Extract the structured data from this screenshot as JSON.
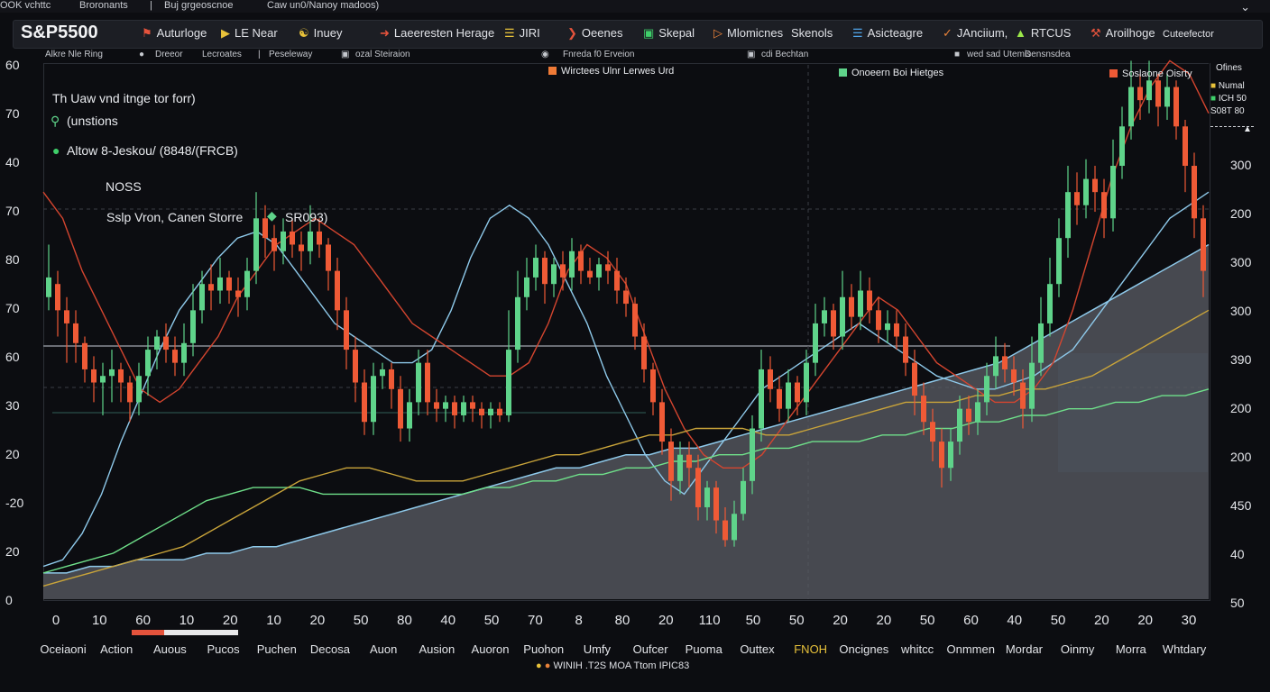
{
  "window": {
    "top_items": [
      "OOK vchttc",
      "Broronants",
      "Buj grgeoscnoe",
      "Caw un0/Nanoy madoos)"
    ]
  },
  "toolbar": {
    "title": "S&P5500",
    "items": [
      {
        "label": "Auturloge",
        "icon": "flag-icon",
        "color": "#e5533c"
      },
      {
        "label": "LE Near",
        "icon": "play-icon",
        "color": "#e8c23a"
      },
      {
        "label": "Inuey",
        "icon": "person-icon",
        "color": "#e8c23a"
      },
      {
        "label": "Laeeresten Herage",
        "icon": "arrow-right-icon",
        "color": "#e5533c"
      },
      {
        "label": "JIRI",
        "icon": "bars-icon",
        "color": "#e8c23a"
      },
      {
        "label": "Oeenes",
        "icon": "chevron-icon",
        "color": "#e5533c"
      },
      {
        "label": "Skepal",
        "icon": "square-icon",
        "color": "#3fcf6a"
      },
      {
        "label": "Mlomicnes",
        "icon": "play-outline-icon",
        "color": "#e8823a"
      },
      {
        "label": "Skenols",
        "icon": "",
        "color": ""
      },
      {
        "label": "Asicteagre",
        "icon": "sliders-icon",
        "color": "#4fa3e8"
      },
      {
        "label": "JAnciium,",
        "icon": "check-icon",
        "color": "#e8823a"
      },
      {
        "label": "RTCUS",
        "icon": "triangle-icon",
        "color": "#9be84a"
      },
      {
        "label": "Aroilhoge",
        "icon": "wrench-icon",
        "color": "#e5533c"
      },
      {
        "label": "Cuteefector",
        "icon": "",
        "color": ""
      }
    ]
  },
  "subbar": {
    "items": [
      "Alkre Nle Ring",
      "Dreeor",
      "Lecroates",
      "Peseleway",
      "ozal Steiraion",
      "Fnreda f0 Erveion",
      "cdi Bechtan",
      "wed sad Utemis",
      "Densnsdea"
    ]
  },
  "annotations": {
    "line1": "Th Uaw vnd itnge tor forr)",
    "line2": "(unstions",
    "line3": "Altow 8-Jeskou/ (8848/(FRCB)",
    "line4": "NOSS",
    "line5": "Sslp Vron, Canen Storre",
    "line5_badge": "SR093)",
    "mid_legend1": "Wirctees Ulnr Lerwes Urd",
    "mid_legend2": "Onoeern Boi Hietges",
    "right_legend": "Soslaone Oisrty"
  },
  "right_legend": {
    "header": "Ofines",
    "items": [
      {
        "label": "Numal",
        "color": "#e8c23a"
      },
      {
        "label": "ICH 50",
        "color": "#3fcf6a"
      },
      {
        "label": "S08T 80",
        "color": "#e8c23a"
      }
    ]
  },
  "footer": {
    "text": "WINIH .T2S MOA Ttom IPIC83"
  },
  "colors": {
    "up": "#5fd38a",
    "down": "#ef5a36",
    "line_blue": "#8ec9ea",
    "line_yellow": "#c9a43a",
    "line_green": "#6fe08a",
    "line_red": "#d4452f",
    "area": "#5b5e66"
  },
  "chart_data": {
    "type": "candlestick",
    "title": "S&P5500",
    "y_left_ticks": [
      "60",
      "70",
      "40",
      "70",
      "80",
      "70",
      "60",
      "30",
      "20",
      "-20",
      "20",
      "0"
    ],
    "y_right_ticks": [
      "300",
      "200",
      "300",
      "300",
      "390",
      "200",
      "200",
      "450",
      "40",
      "50"
    ],
    "x_ticks": [
      "0",
      "10",
      "60",
      "10",
      "20",
      "10",
      "20",
      "50",
      "80",
      "40",
      "50",
      "70",
      "8",
      "80",
      "20",
      "110",
      "50",
      "50",
      "20",
      "20",
      "50",
      "60",
      "40",
      "50",
      "20",
      "20",
      "30"
    ],
    "x_categories": [
      "Oceiaoni",
      "Action",
      "Auous",
      "Pucos",
      "Puchen",
      "Decosa",
      "Auon",
      "Ausion",
      "Auoron",
      "Puohon",
      "Umfy",
      "Oufcer",
      "Puoma",
      "Outtex",
      "FNOH",
      "Oncignes",
      "whitcc",
      "Onmmen",
      "Mordar",
      "Oinmy",
      "Morra",
      "Whtdary"
    ],
    "ylim": [
      0,
      80
    ],
    "candles": [
      [
        0,
        46,
        49,
        54,
        44
      ],
      [
        1,
        48,
        44,
        50,
        40
      ],
      [
        2,
        44,
        42,
        46,
        36
      ],
      [
        3,
        42,
        39,
        44,
        36
      ],
      [
        4,
        39,
        35,
        40,
        33
      ],
      [
        5,
        35,
        33,
        37,
        30
      ],
      [
        6,
        33,
        34,
        36,
        28
      ],
      [
        7,
        34,
        35,
        38,
        30
      ],
      [
        8,
        35,
        33,
        36,
        30
      ],
      [
        9,
        33,
        30,
        34,
        27
      ],
      [
        10,
        30,
        34,
        36,
        28
      ],
      [
        11,
        34,
        38,
        40,
        31
      ],
      [
        12,
        38,
        40,
        41,
        35
      ],
      [
        13,
        40,
        38,
        42,
        36
      ],
      [
        14,
        38,
        36,
        40,
        34
      ],
      [
        15,
        36,
        39,
        42,
        34
      ],
      [
        16,
        39,
        44,
        48,
        37
      ],
      [
        17,
        44,
        48,
        50,
        42
      ],
      [
        18,
        48,
        47,
        51,
        44
      ],
      [
        19,
        47,
        49,
        52,
        45
      ],
      [
        20,
        49,
        47,
        50,
        45
      ],
      [
        21,
        47,
        46,
        49,
        43
      ],
      [
        22,
        46,
        50,
        52,
        44
      ],
      [
        23,
        50,
        58,
        62,
        48
      ],
      [
        24,
        58,
        55,
        60,
        52
      ],
      [
        25,
        55,
        53,
        57,
        50
      ],
      [
        26,
        53,
        56,
        58,
        51
      ],
      [
        27,
        56,
        54,
        58,
        52
      ],
      [
        28,
        54,
        53,
        56,
        50
      ],
      [
        29,
        53,
        56,
        60,
        51
      ],
      [
        30,
        56,
        54,
        58,
        52
      ],
      [
        31,
        54,
        50,
        55,
        47
      ],
      [
        32,
        50,
        44,
        52,
        41
      ],
      [
        33,
        44,
        38,
        46,
        35
      ],
      [
        34,
        38,
        33,
        40,
        30
      ],
      [
        35,
        33,
        27,
        35,
        25
      ],
      [
        36,
        27,
        34,
        36,
        25
      ],
      [
        37,
        34,
        35,
        36,
        32
      ],
      [
        38,
        35,
        32,
        36,
        29
      ],
      [
        39,
        32,
        26,
        34,
        24
      ],
      [
        40,
        26,
        30,
        32,
        24
      ],
      [
        41,
        30,
        36,
        38,
        28
      ],
      [
        42,
        36,
        30,
        38,
        28
      ],
      [
        43,
        30,
        29,
        32,
        27
      ],
      [
        44,
        29,
        30,
        31,
        27
      ],
      [
        45,
        30,
        28,
        31,
        26
      ],
      [
        46,
        28,
        30,
        31,
        27
      ],
      [
        47,
        30,
        29,
        31,
        27
      ],
      [
        48,
        29,
        28,
        30,
        26
      ],
      [
        49,
        28,
        29,
        30,
        26
      ],
      [
        50,
        29,
        28,
        30,
        27
      ],
      [
        51,
        28,
        38,
        44,
        27
      ],
      [
        52,
        38,
        46,
        50,
        36
      ],
      [
        53,
        46,
        49,
        52,
        44
      ],
      [
        54,
        49,
        52,
        54,
        47
      ],
      [
        55,
        52,
        48,
        53,
        45
      ],
      [
        56,
        48,
        51,
        52,
        46
      ],
      [
        57,
        51,
        49,
        53,
        47
      ],
      [
        58,
        49,
        53,
        55,
        47
      ],
      [
        59,
        53,
        50,
        54,
        48
      ],
      [
        60,
        50,
        49,
        52,
        48
      ],
      [
        61,
        49,
        51,
        52,
        47
      ],
      [
        62,
        51,
        50,
        53,
        48
      ],
      [
        63,
        50,
        47,
        52,
        45
      ],
      [
        64,
        47,
        45,
        49,
        43
      ],
      [
        65,
        45,
        40,
        46,
        38
      ],
      [
        66,
        40,
        35,
        42,
        33
      ],
      [
        67,
        35,
        30,
        36,
        28
      ],
      [
        68,
        30,
        24,
        32,
        22
      ],
      [
        69,
        24,
        18,
        26,
        15
      ],
      [
        70,
        18,
        22,
        24,
        16
      ],
      [
        71,
        22,
        20,
        24,
        17
      ],
      [
        72,
        20,
        14,
        22,
        12
      ],
      [
        73,
        14,
        17,
        18,
        12
      ],
      [
        74,
        17,
        12,
        18,
        10
      ],
      [
        75,
        12,
        9,
        14,
        8
      ],
      [
        76,
        9,
        13,
        15,
        8
      ],
      [
        77,
        13,
        18,
        20,
        12
      ],
      [
        78,
        18,
        26,
        28,
        16
      ],
      [
        79,
        26,
        35,
        38,
        24
      ],
      [
        80,
        35,
        32,
        37,
        30
      ],
      [
        81,
        32,
        29,
        34,
        27
      ],
      [
        82,
        29,
        33,
        35,
        27
      ],
      [
        83,
        33,
        30,
        34,
        28
      ],
      [
        84,
        30,
        36,
        38,
        28
      ],
      [
        85,
        36,
        42,
        45,
        34
      ],
      [
        86,
        42,
        44,
        46,
        40
      ],
      [
        87,
        44,
        40,
        45,
        38
      ],
      [
        88,
        40,
        46,
        50,
        38
      ],
      [
        89,
        46,
        43,
        48,
        41
      ],
      [
        90,
        43,
        47,
        50,
        41
      ],
      [
        91,
        47,
        44,
        49,
        42
      ],
      [
        92,
        44,
        41,
        46,
        39
      ],
      [
        93,
        41,
        42,
        44,
        39
      ],
      [
        94,
        42,
        40,
        44,
        38
      ],
      [
        95,
        40,
        36,
        42,
        34
      ],
      [
        96,
        36,
        31,
        38,
        28
      ],
      [
        97,
        31,
        27,
        33,
        25
      ],
      [
        98,
        27,
        24,
        29,
        21
      ],
      [
        99,
        24,
        20,
        26,
        17
      ],
      [
        100,
        20,
        24,
        26,
        18
      ],
      [
        101,
        24,
        29,
        31,
        22
      ],
      [
        102,
        29,
        27,
        31,
        25
      ],
      [
        103,
        27,
        30,
        32,
        25
      ],
      [
        104,
        30,
        34,
        36,
        28
      ],
      [
        105,
        34,
        37,
        40,
        32
      ],
      [
        106,
        37,
        35,
        39,
        33
      ],
      [
        107,
        35,
        33,
        37,
        31
      ],
      [
        108,
        33,
        29,
        35,
        26
      ],
      [
        109,
        29,
        36,
        40,
        27
      ],
      [
        110,
        36,
        42,
        46,
        34
      ],
      [
        111,
        42,
        48,
        52,
        40
      ],
      [
        112,
        48,
        55,
        58,
        46
      ],
      [
        113,
        55,
        62,
        66,
        52
      ],
      [
        114,
        62,
        60,
        65,
        57
      ],
      [
        115,
        60,
        64,
        67,
        58
      ],
      [
        116,
        64,
        62,
        66,
        59
      ],
      [
        117,
        62,
        58,
        64,
        55
      ],
      [
        118,
        58,
        66,
        70,
        56
      ],
      [
        119,
        66,
        72,
        75,
        64
      ],
      [
        120,
        72,
        78,
        82,
        70
      ],
      [
        121,
        78,
        76,
        80,
        73
      ],
      [
        122,
        76,
        79,
        82,
        74
      ],
      [
        123,
        79,
        75,
        80,
        72
      ],
      [
        124,
        75,
        78,
        80,
        73
      ],
      [
        125,
        78,
        72,
        79,
        70
      ],
      [
        126,
        72,
        66,
        73,
        62
      ],
      [
        127,
        66,
        58,
        68,
        55
      ],
      [
        128,
        58,
        50,
        60,
        46
      ]
    ],
    "lines": [
      {
        "color": "blue",
        "values": [
          5,
          6,
          10,
          16,
          24,
          31,
          38,
          44,
          48,
          52,
          55,
          56,
          54,
          50,
          46,
          42,
          40,
          38,
          36,
          36,
          38,
          44,
          52,
          58,
          60,
          58,
          54,
          48,
          42,
          34,
          28,
          22,
          18,
          16,
          20,
          24,
          28,
          32,
          34,
          36,
          38,
          40,
          42,
          40,
          38,
          36,
          34,
          33,
          32,
          32,
          33,
          34,
          36,
          38,
          42,
          46,
          50,
          54,
          58,
          60,
          62
        ]
      },
      {
        "color": "red",
        "values": [
          62,
          58,
          50,
          44,
          38,
          32,
          30,
          32,
          36,
          40,
          46,
          50,
          54,
          56,
          58,
          56,
          54,
          50,
          46,
          42,
          40,
          38,
          36,
          34,
          34,
          36,
          42,
          50,
          54,
          52,
          48,
          40,
          32,
          26,
          22,
          20,
          20,
          22,
          26,
          30,
          34,
          38,
          42,
          46,
          44,
          40,
          36,
          34,
          32,
          30,
          30,
          32,
          36,
          44,
          54,
          64,
          72,
          78,
          82,
          80,
          74
        ]
      },
      {
        "color": "green",
        "values": [
          4,
          5,
          6,
          7,
          9,
          11,
          13,
          15,
          16,
          17,
          17,
          17,
          16,
          16,
          16,
          16,
          16,
          16,
          16,
          17,
          17,
          18,
          18,
          19,
          19,
          20,
          20,
          21,
          21,
          22,
          22,
          23,
          23,
          24,
          24,
          24,
          25,
          25,
          26,
          26,
          27,
          27,
          28,
          28,
          29,
          29,
          30,
          30,
          31,
          31,
          32
        ]
      },
      {
        "color": "yellow",
        "values": [
          2,
          3,
          4,
          5,
          6,
          7,
          8,
          10,
          12,
          14,
          16,
          18,
          19,
          20,
          20,
          19,
          18,
          18,
          18,
          19,
          20,
          21,
          22,
          22,
          23,
          24,
          25,
          25,
          26,
          26,
          26,
          25,
          25,
          26,
          27,
          28,
          29,
          30,
          30,
          30,
          31,
          31,
          32,
          32,
          33,
          34,
          36,
          38,
          40,
          42,
          44
        ]
      }
    ],
    "area_values": [
      4,
      4,
      5,
      5,
      6,
      6,
      6,
      7,
      7,
      8,
      8,
      9,
      10,
      11,
      12,
      13,
      14,
      15,
      16,
      17,
      18,
      19,
      20,
      20,
      21,
      22,
      22,
      23,
      23,
      24,
      25,
      26,
      27,
      28,
      29,
      30,
      31,
      32,
      33,
      34,
      35,
      36,
      38,
      40,
      42,
      44,
      46,
      48,
      50,
      52,
      54
    ]
  }
}
